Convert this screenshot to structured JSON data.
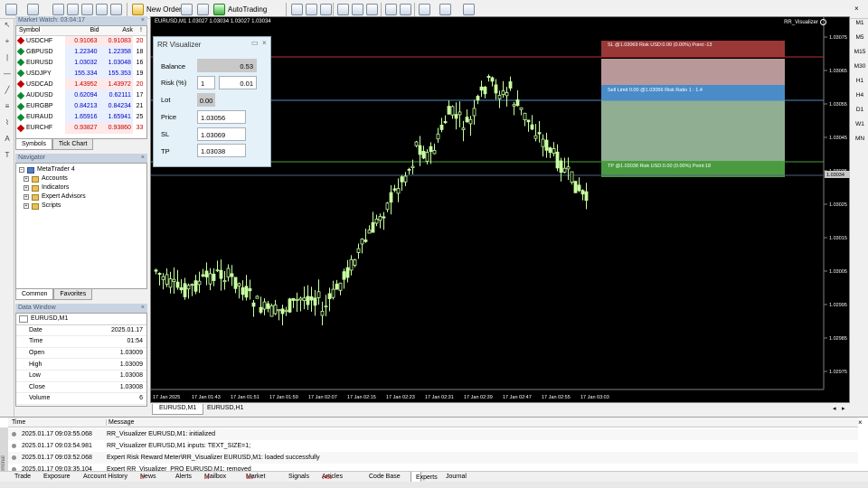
{
  "toolbar": {
    "new_order": "New Order",
    "autotrading": "AutoTrading"
  },
  "market_watch": {
    "title": "Market Watch: 03:04:17",
    "columns": [
      "Symbol",
      "Bid",
      "Ask",
      "!"
    ],
    "rows": [
      {
        "symbol": "USDCHF",
        "bid": "0.91063",
        "ask": "0.91083",
        "spread": "20",
        "dir": "down"
      },
      {
        "symbol": "GBPUSD",
        "bid": "1.22340",
        "ask": "1.22358",
        "spread": "18",
        "dir": "up"
      },
      {
        "symbol": "EURUSD",
        "bid": "1.03032",
        "ask": "1.03048",
        "spread": "16",
        "dir": "up"
      },
      {
        "symbol": "USDJPY",
        "bid": "155.334",
        "ask": "155.353",
        "spread": "19",
        "dir": "up"
      },
      {
        "symbol": "USDCAD",
        "bid": "1.43952",
        "ask": "1.43972",
        "spread": "20",
        "dir": "down"
      },
      {
        "symbol": "AUDUSD",
        "bid": "0.62094",
        "ask": "0.62111",
        "spread": "17",
        "dir": "up"
      },
      {
        "symbol": "EURGBP",
        "bid": "0.84213",
        "ask": "0.84234",
        "spread": "21",
        "dir": "up"
      },
      {
        "symbol": "EURAUD",
        "bid": "1.65916",
        "ask": "1.65941",
        "spread": "25",
        "dir": "up"
      },
      {
        "symbol": "EURCHF",
        "bid": "0.93827",
        "ask": "0.93860",
        "spread": "33",
        "dir": "down"
      }
    ],
    "tabs": [
      "Symbols",
      "Tick Chart"
    ]
  },
  "navigator": {
    "title": "Navigator",
    "root": "MetaTrader 4",
    "items": [
      "Accounts",
      "Indicators",
      "Expert Advisors",
      "Scripts"
    ],
    "tabs": [
      "Common",
      "Favorites"
    ]
  },
  "data_window": {
    "title": "Data Window",
    "symbol": "EURUSD,M1",
    "rows": [
      {
        "label": "Date",
        "value": "2025.01.17"
      },
      {
        "label": "Time",
        "value": "01:54"
      },
      {
        "label": "Open",
        "value": "1.03009"
      },
      {
        "label": "High",
        "value": "1.03009"
      },
      {
        "label": "Low",
        "value": "1.03008"
      },
      {
        "label": "Close",
        "value": "1.03008"
      },
      {
        "label": "Volume",
        "value": "6"
      }
    ]
  },
  "chart": {
    "title": "EURUSD,M1  1.03027 1.03034 1.03027 1.03034",
    "indicator": "RR_Visualizer",
    "price_labels": [
      "1.03075",
      "1.03065",
      "1.03055",
      "1.03045",
      "1.03035",
      "1.03025",
      "1.03015",
      "1.03005",
      "1.02995",
      "1.02985",
      "1.02975"
    ],
    "current_price": "1.03034",
    "time_labels": [
      "17 Jan 2025",
      "17 Jan 01:43",
      "17 Jan 01:51",
      "17 Jan 01:59",
      "17 Jan 02:07",
      "17 Jan 02:15",
      "17 Jan 02:23",
      "17 Jan 02:31",
      "17 Jan 02:39",
      "17 Jan 02:47",
      "17 Jan 02:55",
      "17 Jan 03:03"
    ],
    "sl_label": "SL @1.03069 Risk USD:0.00 (0.00%) Point:-13",
    "entry_label": "Sell Limit 0.00 @1.03056 Risk Ratio 1 : 1.4",
    "tp_label": "TP @1.03038 Risk USD:0.00 (0.00%) Point:18"
  },
  "rr_panel": {
    "title": "RR Visualizer",
    "balance_label": "Balance",
    "balance": "0.53",
    "risk_label": "Risk (%)",
    "risk_value": "1",
    "risk_pct": "0.01",
    "lot_label": "Lot",
    "lot": "0.00",
    "price_label": "Price",
    "price": "1.03056",
    "sl_label": "SL",
    "sl": "1.03069",
    "tp_label": "TP",
    "tp": "1.03038"
  },
  "timeframes": [
    "M1",
    "M5",
    "M15",
    "M30",
    "H1",
    "H4",
    "D1",
    "W1",
    "MN"
  ],
  "chart_tabs": [
    "EURUSD,M1",
    "EURUSD,H1"
  ],
  "terminal": {
    "columns": [
      "Time",
      "Message"
    ],
    "logs": [
      {
        "time": "2025.01.17 09:03:55.068",
        "msg": "RR_Visualizer EURUSD,M1: initialized"
      },
      {
        "time": "2025.01.17 09:03:54.981",
        "msg": "RR_Visualizer EURUSD,M1 inputs: TEXT_SIZE=1;"
      },
      {
        "time": "2025.01.17 09:03:52.068",
        "msg": "Expert Risk Reward Meter\\RR_Visualizer EURUSD,M1: loaded successfully"
      },
      {
        "time": "2025.01.17 09:03:35.104",
        "msg": "Expert RR_Visualizer_PRO EURUSD,M1: removed"
      }
    ],
    "side_label": "Terminal",
    "tabs": [
      {
        "label": "Trade",
        "badge": ""
      },
      {
        "label": "Exposure",
        "badge": ""
      },
      {
        "label": "Account History",
        "badge": ""
      },
      {
        "label": "News",
        "badge": "37"
      },
      {
        "label": "Alerts",
        "badge": ""
      },
      {
        "label": "Mailbox",
        "badge": "21"
      },
      {
        "label": "Market",
        "badge": "115"
      },
      {
        "label": "Signals",
        "badge": ""
      },
      {
        "label": "Articles",
        "badge": "1450"
      },
      {
        "label": "Code Base",
        "badge": ""
      },
      {
        "label": "Experts",
        "badge": ""
      },
      {
        "label": "Journal",
        "badge": ""
      }
    ]
  },
  "colors": {
    "candle": "#c8ffa0",
    "sl_line": "#c03030",
    "entry_line": "#4a8cc8",
    "tp_line": "#4aa040",
    "sl_zone": "#b89898",
    "tp_zone": "#8fae92"
  }
}
